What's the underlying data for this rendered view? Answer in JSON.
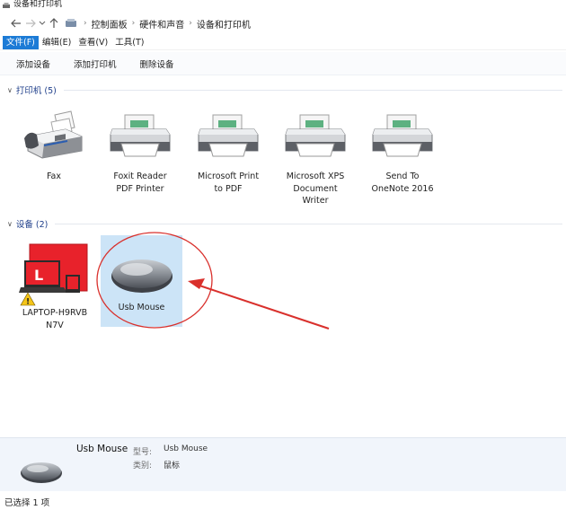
{
  "window": {
    "title": "设备和打印机"
  },
  "address": {
    "back_icon": "arrow-left-icon",
    "forward_icon": "arrow-right-icon",
    "recent_icon": "chevron-down-icon",
    "up_icon": "arrow-up-icon",
    "crumbs": [
      "控制面板",
      "硬件和声音",
      "设备和打印机"
    ]
  },
  "menu": [
    "文件(F)",
    "编辑(E)",
    "查看(V)",
    "工具(T)"
  ],
  "commands": [
    "添加设备",
    "添加打印机",
    "删除设备"
  ],
  "groups": {
    "printers": {
      "header": "打印机 (5)",
      "items": [
        {
          "label_lines": [
            "Fax"
          ],
          "icon": "fax-machine-icon"
        },
        {
          "label_lines": [
            "Foxit Reader",
            "PDF Printer"
          ],
          "icon": "printer-icon"
        },
        {
          "label_lines": [
            "Microsoft Print",
            "to PDF"
          ],
          "icon": "printer-icon"
        },
        {
          "label_lines": [
            "Microsoft XPS",
            "Document",
            "Writer"
          ],
          "icon": "printer-icon"
        },
        {
          "label_lines": [
            "Send To",
            "OneNote 2016"
          ],
          "icon": "printer-icon"
        }
      ]
    },
    "devices": {
      "header": "设备 (2)",
      "items": [
        {
          "label_lines": [
            "LAPTOP-H9RVB",
            "N7V"
          ],
          "icon": "laptop-warning-icon"
        },
        {
          "label_lines": [
            "Usb Mouse"
          ],
          "icon": "mouse-icon",
          "selected": true
        }
      ]
    }
  },
  "details": {
    "name": "Usb Mouse",
    "model_label": "型号:",
    "model_value": "Usb Mouse",
    "category_label": "类别:",
    "category_value": "鼠标"
  },
  "status": {
    "selection": "已选择 1 项"
  },
  "colors": {
    "accent": "#1c7bd6",
    "selection": "#cce4f7",
    "annotation": "#d9302c",
    "laptop_red": "#e8222b"
  }
}
